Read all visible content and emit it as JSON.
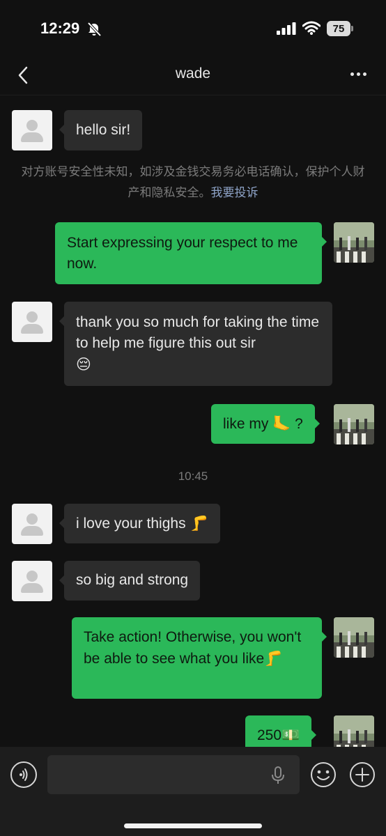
{
  "status_bar": {
    "time": "12:29",
    "battery": "75"
  },
  "nav": {
    "title": "wade"
  },
  "messages": [
    {
      "side": "in",
      "text": "hello sir!"
    },
    {
      "side": "out",
      "text": "Start expressing your respect to me now."
    },
    {
      "side": "in",
      "text": "thank you so much for taking the time to help me figure this out sir",
      "emoji": "😔"
    },
    {
      "side": "out",
      "text": "like my",
      "emoji": "🦶",
      "suffix": " ?"
    },
    {
      "side": "in",
      "text": "i love your thighs",
      "emoji": "🦵"
    },
    {
      "side": "in",
      "text": "so big and strong"
    },
    {
      "side": "out",
      "text": "Take action! Otherwise, you won't be able to see what you like",
      "emoji": "🦵"
    },
    {
      "side": "out",
      "text": "250",
      "emoji": "💵"
    }
  ],
  "notice": {
    "text": "对方账号安全性未知，如涉及金钱交易务必电话确认，保护个人财产和隐私安全。",
    "link": "我要投诉"
  },
  "timestamp": "10:45",
  "input": {
    "placeholder": ""
  },
  "colors": {
    "background": "#111111",
    "bubble_out": "#2bb859",
    "bubble_in": "#2c2c2c",
    "link": "#8ea3c7"
  },
  "icons": [
    "back-chevron-icon",
    "more-dots-icon",
    "bell-slash-icon",
    "signal-icon",
    "wifi-icon",
    "voice-icon",
    "microphone-icon",
    "emoji-icon",
    "plus-icon"
  ]
}
